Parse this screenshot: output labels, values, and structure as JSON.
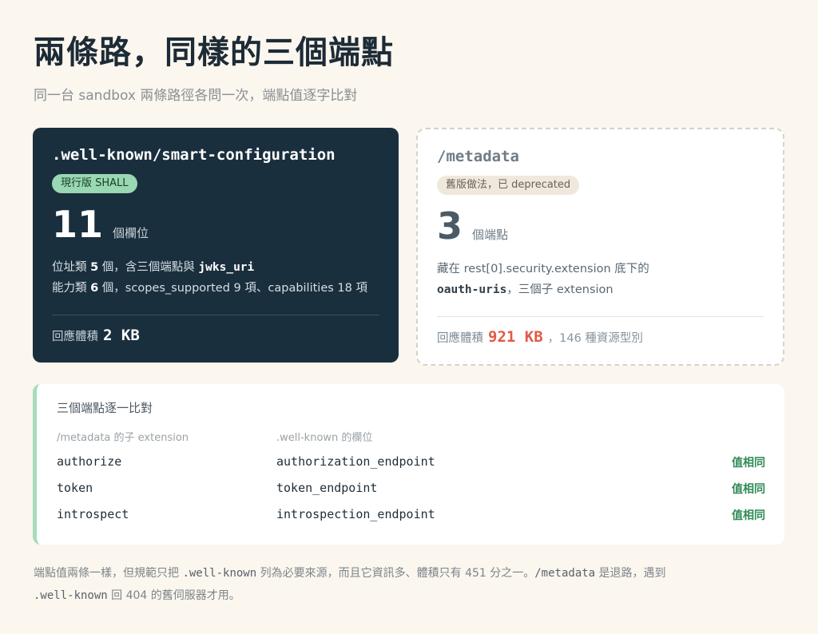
{
  "header": {
    "title": "兩條路，同樣的三個端點",
    "subtitle": "同一台 sandbox 兩條路徑各問一次，端點值逐字比對"
  },
  "well_known": {
    "endpoint": ".well-known/smart-configuration",
    "badge": "現行版 SHALL",
    "count": "11",
    "count_unit": "個欄位",
    "line1": {
      "prefix": "位址類 ",
      "num": "5",
      "mid": " 個，含三個端點與 ",
      "strong": "jwks_uri"
    },
    "line2": {
      "prefix": "能力類 ",
      "num": "6",
      "rest": " 個，scopes_supported 9 項、capabilities 18 項"
    },
    "size_label": "回應體積",
    "size_value": "2 KB"
  },
  "metadata": {
    "endpoint": "/metadata",
    "badge": "舊版做法，已 deprecated",
    "count": "3",
    "count_unit": "個端點",
    "line1": "藏在 rest[0].security.extension 底下的",
    "line2": {
      "strong": "oauth-uris",
      "rest": "，三個子 extension"
    },
    "size_label": "回應體積",
    "size_value": "921 KB",
    "size_extra": "，146 種資源型別"
  },
  "comparison": {
    "title": "三個端點逐一比對",
    "col1_header": "/metadata 的子 extension",
    "col2_header": ".well-known 的欄位",
    "rows": [
      {
        "meta": "authorize",
        "wellknown": "authorization_endpoint",
        "status": "值相同"
      },
      {
        "meta": "token",
        "wellknown": "token_endpoint",
        "status": "值相同"
      },
      {
        "meta": "introspect",
        "wellknown": "introspection_endpoint",
        "status": "值相同"
      }
    ]
  },
  "footnote": {
    "t1": "端點值兩條一樣，但規範只把 ",
    "c1": ".well-known",
    "t2": " 列為必要來源，而且它資訊多、體積只有 451 分之一。",
    "c2": "/metadata",
    "t3": " 是退路，遇到 ",
    "c3": ".well-known",
    "t4": " 回 404 的舊伺服器才用。"
  },
  "colors": {
    "background": "#fbf6ee",
    "dark_card": "#1a2f3e",
    "green_badge": "#9ad8b3",
    "size_alert": "#e05a47",
    "match_green": "#2e8a56",
    "panel_accent": "#a5dcbd"
  }
}
